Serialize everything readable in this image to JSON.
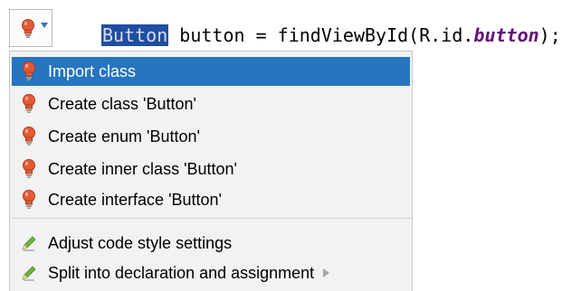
{
  "editor": {
    "code_selected_token": "Button",
    "code_before_field": " button = findViewById(R.id.",
    "code_field": "button",
    "code_after_field": ");"
  },
  "trigger": {
    "icon": "red-lightbulb-icon",
    "dropdown_icon": "caret-down-icon"
  },
  "menu": {
    "items": [
      {
        "label": "Import class",
        "icon": "red-lightbulb-icon",
        "selected": true
      },
      {
        "label": "Create class 'Button'",
        "icon": "red-lightbulb-icon",
        "selected": false
      },
      {
        "label": "Create enum 'Button'",
        "icon": "red-lightbulb-icon",
        "selected": false
      },
      {
        "label": "Create inner class 'Button'",
        "icon": "red-lightbulb-icon",
        "selected": false
      },
      {
        "label": "Create interface 'Button'",
        "icon": "red-lightbulb-icon",
        "selected": false
      },
      {
        "label": "Adjust code style settings",
        "icon": "pencil-icon",
        "selected": false
      },
      {
        "label": "Split into declaration and assignment",
        "icon": "pencil-icon",
        "selected": false,
        "has_submenu": true
      }
    ]
  },
  "colors": {
    "selection_bg": "#2675bf",
    "bulb_red": "#e05a35",
    "field_purple": "#660e7a",
    "pencil_green": "#5fa83a"
  }
}
